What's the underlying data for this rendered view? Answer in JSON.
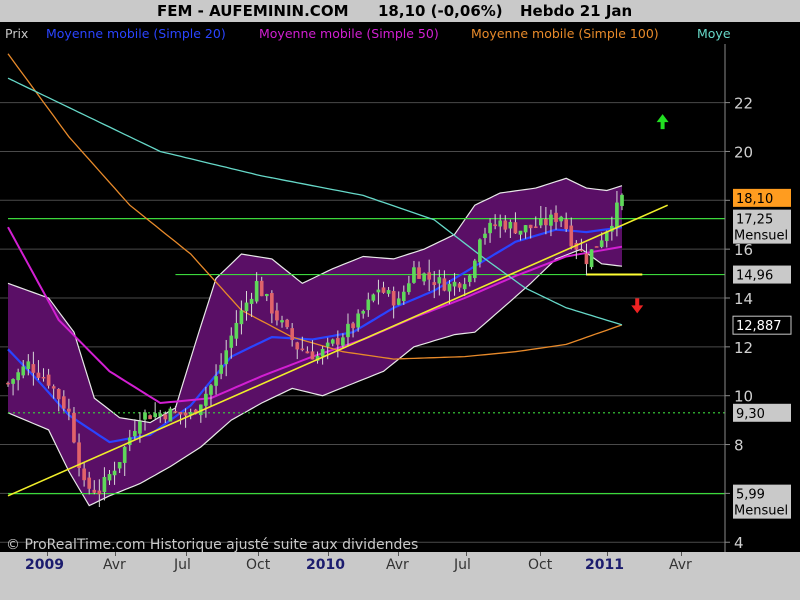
{
  "header": {
    "symbol": "FEM - AUFEMININ.COM",
    "quote": "18,10 (-0,06%)",
    "period": "Hebdo  21 Jan"
  },
  "legend": [
    {
      "label": "Prix",
      "color": "#c8c8c8"
    },
    {
      "label": "Moyenne mobile (Simple 20)",
      "color": "#2a44ff"
    },
    {
      "label": "Moyenne mobile (Simple 50)",
      "color": "#d21fd2"
    },
    {
      "label": "Moyenne mobile (Simple 100)",
      "color": "#e88a2a"
    },
    {
      "label": "Moye",
      "color": "#66d8c8"
    }
  ],
  "watermark": "© ProRealTime.com Historique ajusté suite aux dividendes",
  "chart_data": {
    "type": "candlestick",
    "title": "FEM - AUFEMININ.COM",
    "timeframe": "Hebdo",
    "ylim": [
      3.6,
      24.4
    ],
    "yticks": [
      4,
      6,
      8,
      10,
      12,
      14,
      16,
      18,
      20,
      22
    ],
    "xticks": [
      "2009",
      "Avr",
      "Jul",
      "Oct",
      "2010",
      "Avr",
      "Jul",
      "Oct",
      "2011",
      "Avr"
    ],
    "grid": true,
    "price_keypoints": [
      {
        "i": 0,
        "v": 10.5
      },
      {
        "i": 4,
        "v": 11.3
      },
      {
        "i": 8,
        "v": 10.6
      },
      {
        "i": 12,
        "v": 9.3
      },
      {
        "i": 15,
        "v": 6.3
      },
      {
        "i": 18,
        "v": 6.1
      },
      {
        "i": 22,
        "v": 7.4
      },
      {
        "i": 26,
        "v": 9.2
      },
      {
        "i": 32,
        "v": 9.3
      },
      {
        "i": 36,
        "v": 9.2
      },
      {
        "i": 41,
        "v": 10.7
      },
      {
        "i": 45,
        "v": 13.0
      },
      {
        "i": 49,
        "v": 14.6
      },
      {
        "i": 53,
        "v": 13.2
      },
      {
        "i": 57,
        "v": 12.0
      },
      {
        "i": 61,
        "v": 11.6
      },
      {
        "i": 65,
        "v": 12.3
      },
      {
        "i": 69,
        "v": 13.1
      },
      {
        "i": 73,
        "v": 14.4
      },
      {
        "i": 77,
        "v": 13.8
      },
      {
        "i": 80,
        "v": 15.2
      },
      {
        "i": 83,
        "v": 14.8
      },
      {
        "i": 87,
        "v": 14.5
      },
      {
        "i": 91,
        "v": 14.9
      },
      {
        "i": 93,
        "v": 16.6
      },
      {
        "i": 97,
        "v": 17.1
      },
      {
        "i": 101,
        "v": 16.8
      },
      {
        "i": 105,
        "v": 17.0
      },
      {
        "i": 109,
        "v": 17.4
      },
      {
        "i": 111,
        "v": 16.4
      },
      {
        "i": 114,
        "v": 15.6
      },
      {
        "i": 117,
        "v": 16.5
      },
      {
        "i": 119,
        "v": 17.2
      },
      {
        "i": 121,
        "v": 18.1
      }
    ],
    "bars": 122,
    "moving_averages": [
      {
        "name": "Moyenne mobile (Simple 20)",
        "color": "#2a44ff",
        "width": 2.2,
        "points": [
          [
            0,
            11.9
          ],
          [
            6,
            10.6
          ],
          [
            12,
            9.2
          ],
          [
            20,
            8.1
          ],
          [
            28,
            8.4
          ],
          [
            36,
            9.6
          ],
          [
            44,
            11.6
          ],
          [
            52,
            12.4
          ],
          [
            60,
            12.3
          ],
          [
            68,
            12.6
          ],
          [
            76,
            13.6
          ],
          [
            84,
            14.3
          ],
          [
            92,
            15.3
          ],
          [
            100,
            16.3
          ],
          [
            108,
            16.8
          ],
          [
            114,
            16.7
          ],
          [
            121,
            16.9
          ]
        ]
      },
      {
        "name": "Moyenne mobile (Simple 50)",
        "color": "#d21fd2",
        "width": 2.0,
        "points": [
          [
            0,
            16.9
          ],
          [
            10,
            13.1
          ],
          [
            20,
            11.0
          ],
          [
            30,
            9.7
          ],
          [
            40,
            9.9
          ],
          [
            50,
            10.8
          ],
          [
            60,
            11.6
          ],
          [
            70,
            12.3
          ],
          [
            80,
            13.2
          ],
          [
            90,
            14.0
          ],
          [
            100,
            14.9
          ],
          [
            110,
            15.7
          ],
          [
            121,
            16.1
          ]
        ]
      },
      {
        "name": "Moyenne mobile (Simple 100)",
        "color": "#e88a2a",
        "width": 1.3,
        "points": [
          [
            0,
            24.0
          ],
          [
            12,
            20.6
          ],
          [
            24,
            17.8
          ],
          [
            36,
            15.8
          ],
          [
            46,
            13.5
          ],
          [
            56,
            12.4
          ],
          [
            66,
            11.8
          ],
          [
            76,
            11.5
          ],
          [
            90,
            11.6
          ],
          [
            100,
            11.8
          ],
          [
            110,
            12.1
          ],
          [
            121,
            12.9
          ]
        ]
      },
      {
        "name": "Moye",
        "color": "#66d8c8",
        "width": 1.3,
        "points": [
          [
            0,
            23.0
          ],
          [
            12,
            21.8
          ],
          [
            30,
            20.0
          ],
          [
            50,
            19.0
          ],
          [
            70,
            18.2
          ],
          [
            84,
            17.2
          ],
          [
            94,
            15.6
          ],
          [
            102,
            14.4
          ],
          [
            110,
            13.6
          ],
          [
            121,
            12.9
          ]
        ]
      }
    ],
    "bollinger_upper": [
      [
        0,
        14.6
      ],
      [
        8,
        14.0
      ],
      [
        13,
        12.6
      ],
      [
        17,
        9.9
      ],
      [
        22,
        9.1
      ],
      [
        28,
        8.9
      ],
      [
        33,
        9.5
      ],
      [
        37,
        12.2
      ],
      [
        41,
        14.8
      ],
      [
        46,
        15.8
      ],
      [
        52,
        15.6
      ],
      [
        58,
        14.6
      ],
      [
        64,
        15.2
      ],
      [
        70,
        15.7
      ],
      [
        76,
        15.6
      ],
      [
        82,
        16.0
      ],
      [
        88,
        16.6
      ],
      [
        92,
        17.8
      ],
      [
        97,
        18.3
      ],
      [
        104,
        18.5
      ],
      [
        110,
        18.9
      ],
      [
        114,
        18.5
      ],
      [
        118,
        18.4
      ],
      [
        121,
        18.6
      ]
    ],
    "bollinger_lower": [
      [
        0,
        9.3
      ],
      [
        8,
        8.6
      ],
      [
        12,
        6.9
      ],
      [
        16,
        5.5
      ],
      [
        20,
        5.9
      ],
      [
        26,
        6.4
      ],
      [
        32,
        7.1
      ],
      [
        38,
        7.9
      ],
      [
        44,
        9.0
      ],
      [
        50,
        9.7
      ],
      [
        56,
        10.3
      ],
      [
        62,
        10.0
      ],
      [
        68,
        10.5
      ],
      [
        74,
        11.0
      ],
      [
        80,
        12.0
      ],
      [
        88,
        12.5
      ],
      [
        92,
        12.6
      ],
      [
        97,
        13.5
      ],
      [
        103,
        14.6
      ],
      [
        108,
        15.6
      ],
      [
        113,
        16.0
      ],
      [
        117,
        15.4
      ],
      [
        121,
        15.3
      ]
    ],
    "trendline": {
      "color": "#f0ee2a",
      "from": [
        0,
        5.9
      ],
      "to": [
        130,
        17.8
      ]
    },
    "horizontal_levels": [
      {
        "value": 17.25,
        "color": "#3cd83c",
        "style": "solid",
        "from": 0
      },
      {
        "value": 14.96,
        "color": "#3cd83c",
        "style": "solid",
        "from": 33
      },
      {
        "value": 9.3,
        "color": "#3cd83c",
        "style": "dotted",
        "from": 0
      },
      {
        "value": 5.99,
        "color": "#3cd83c",
        "style": "solid",
        "from": 0
      },
      {
        "value": 14.96,
        "color": "#ffff33",
        "style": "solid",
        "from": 114,
        "to": 125
      }
    ],
    "arrows": [
      {
        "direction": "up",
        "at": [
          129,
          21.2
        ],
        "color": "#22e022"
      },
      {
        "direction": "down",
        "at": [
          124,
          13.7
        ],
        "color": "#ee2222"
      }
    ],
    "right_labels": [
      {
        "value": 18.1,
        "text": "18,10",
        "sub": "",
        "bg": "#ff9c1f",
        "fg": "#000"
      },
      {
        "value": 17.25,
        "text": "17,25",
        "sub": "Mensuel",
        "bg": "#c9c9c9",
        "fg": "#000"
      },
      {
        "value": 14.96,
        "text": "14,96",
        "sub": "",
        "bg": "#c9c9c9",
        "fg": "#000"
      },
      {
        "value": 12.887,
        "text": "12,887",
        "sub": "",
        "bg": "#000",
        "fg": "#fff"
      },
      {
        "value": 9.3,
        "text": "9,30",
        "sub": "",
        "bg": "#c9c9c9",
        "fg": "#000"
      },
      {
        "value": 5.99,
        "text": "5,99",
        "sub": "Mensuel",
        "bg": "#c9c9c9",
        "fg": "#000"
      }
    ]
  }
}
